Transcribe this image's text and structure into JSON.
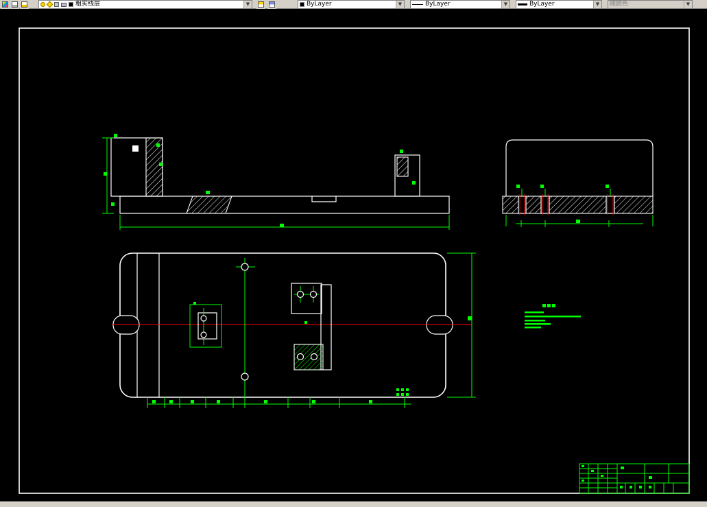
{
  "toolbar": {
    "layer": {
      "value": "粗实线层"
    },
    "color": {
      "value": "ByLayer"
    },
    "linetype": {
      "value": "ByLayer"
    },
    "lineweight": {
      "value": "ByLayer"
    },
    "plot_style": {
      "value": "随颜色"
    }
  },
  "icons": {
    "dropdown_arrow": "▼"
  },
  "colors": {
    "drawing_line": "#00ff00",
    "outline": "#ffffff",
    "centerline": "#ff0000",
    "toolbar_bg": "#d4d0c8",
    "background": "#000000"
  }
}
